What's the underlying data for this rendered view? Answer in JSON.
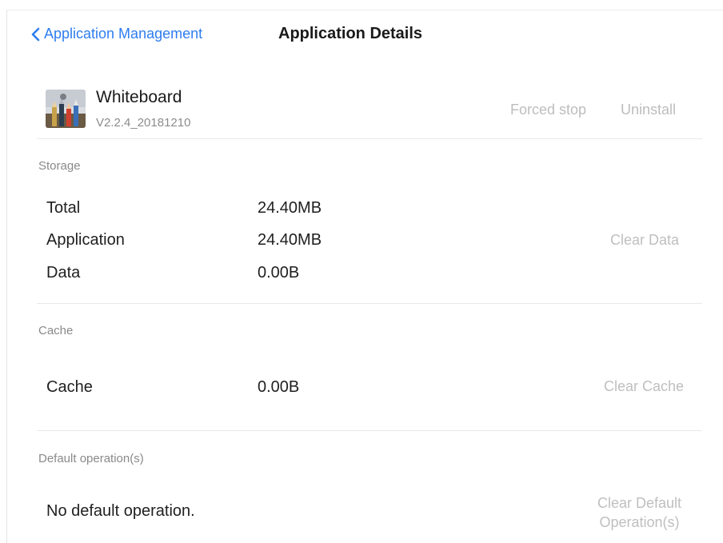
{
  "header": {
    "back_label": "Application Management",
    "title": "Application Details"
  },
  "app": {
    "name": "Whiteboard",
    "version": "V2.2.4_20181210",
    "forced_stop_label": "Forced stop",
    "uninstall_label": "Uninstall"
  },
  "storage": {
    "section_label": "Storage",
    "rows": [
      {
        "label": "Total",
        "value": "24.40MB"
      },
      {
        "label": "Application",
        "value": "24.40MB"
      },
      {
        "label": "Data",
        "value": "0.00B"
      }
    ],
    "clear_label": "Clear Data"
  },
  "cache": {
    "section_label": "Cache",
    "row": {
      "label": "Cache",
      "value": "0.00B"
    },
    "clear_label": "Clear Cache"
  },
  "defaults": {
    "section_label": "Default operation(s)",
    "text": "No default operation.",
    "clear_label_line1": "Clear Default",
    "clear_label_line2": "Operation(s)"
  },
  "colors": {
    "accent": "#2e7df0",
    "disabled_text": "#bdbdbd",
    "secondary_text": "#8a8a8a"
  },
  "icons": {
    "back": "chevron-left-icon",
    "app": "whiteboard-app-icon"
  }
}
